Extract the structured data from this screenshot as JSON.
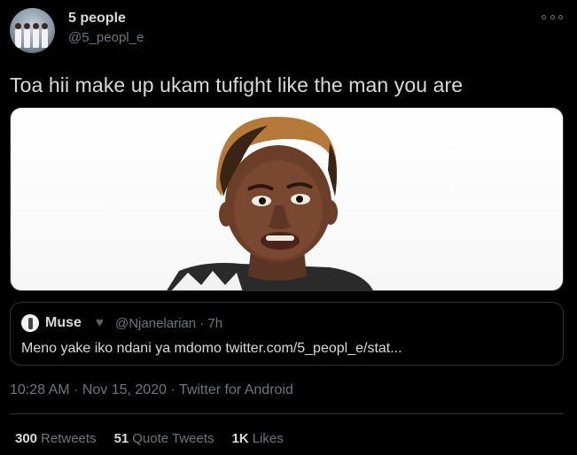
{
  "author": {
    "name": "5 people",
    "handle": "@5_peopl_e"
  },
  "tweet": {
    "text": "Toa hii make up ukam tufight like the man you are",
    "timestamp": "10:28 AM · Nov 15, 2020 · Twitter for Android"
  },
  "quoted_tweet": {
    "name": "Muse",
    "handle": "@Njanelarian · 7h",
    "text": "Meno yake iko ndani ya mdomo twitter.com/5_peopl_e/stat..."
  },
  "stats": {
    "retweets_count": "300",
    "retweets_label": "Retweets",
    "quotes_count": "51",
    "quotes_label": "Quote Tweets",
    "likes_count": "1K",
    "likes_label": "Likes"
  },
  "icons": {
    "more": "more-options-icon",
    "heart": "black-heart-icon"
  },
  "colors": {
    "background": "#000000",
    "text": "#d9d9d9",
    "secondary_text": "#6e767d",
    "border": "#2f3336"
  }
}
